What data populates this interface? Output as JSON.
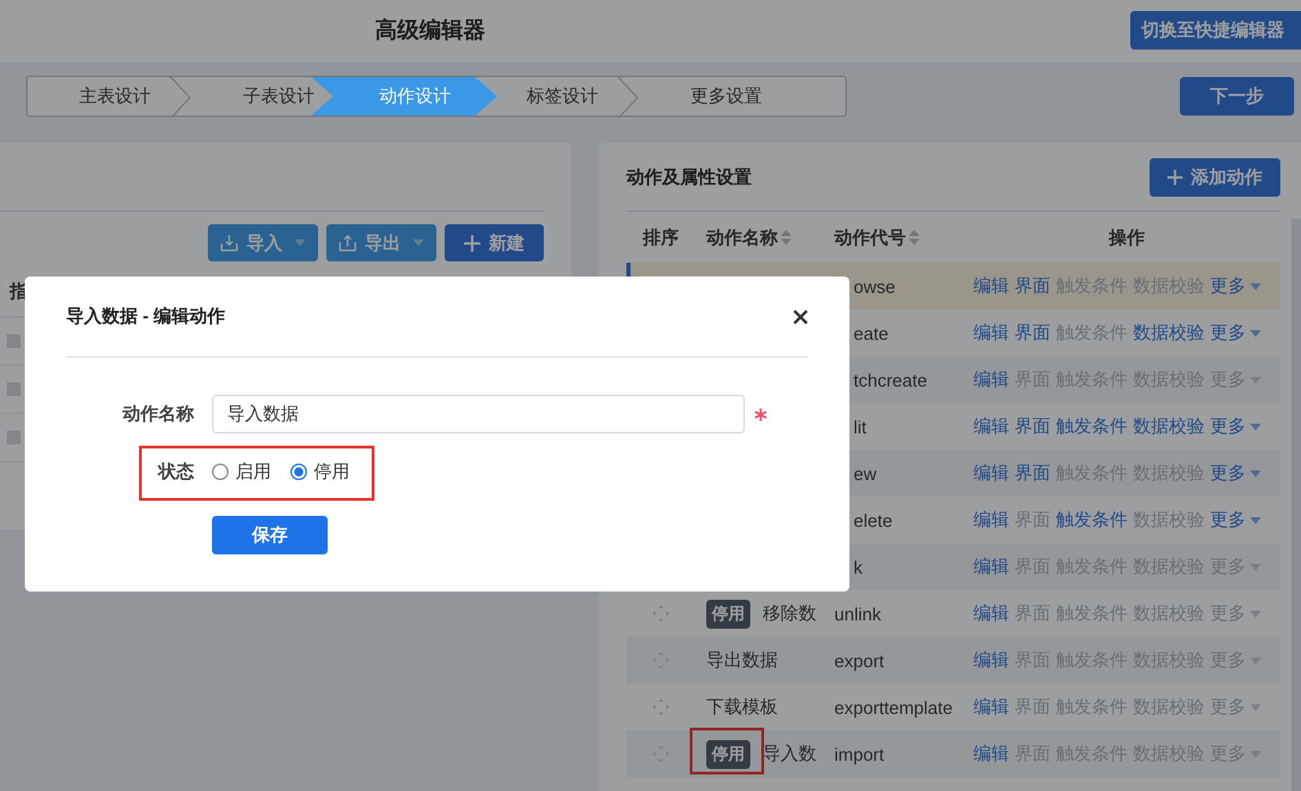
{
  "header": {
    "title": "高级编辑器",
    "switch_button": "切换至快捷编辑器"
  },
  "steps": [
    {
      "label": "主表设计",
      "selected": false
    },
    {
      "label": "子表设计",
      "selected": false
    },
    {
      "label": "动作设计",
      "selected": true
    },
    {
      "label": "标签设计",
      "selected": false
    },
    {
      "label": "更多设置",
      "selected": false
    }
  ],
  "next_button": "下一步",
  "left_panel": {
    "buttons": [
      {
        "kind": "import",
        "label": "导入"
      },
      {
        "kind": "export",
        "label": "导出"
      },
      {
        "kind": "new",
        "label": "新建"
      }
    ],
    "column_1": "指"
  },
  "actions_panel": {
    "title": "动作及属性设置",
    "add_button": "添加动作",
    "columns": [
      {
        "label": "排序",
        "kind": "plain"
      },
      {
        "label": "动作名称",
        "kind": "sortable"
      },
      {
        "label": "动作代号",
        "kind": "sortable"
      },
      {
        "label": "操作",
        "kind": "plain"
      }
    ],
    "rows": [
      {
        "code": "owse",
        "selected": true,
        "ops": [
          {
            "label": "编辑",
            "enabled": true
          },
          {
            "label": "界面",
            "enabled": true
          },
          {
            "label": "触发条件",
            "enabled": false
          },
          {
            "label": "数据校验",
            "enabled": false
          },
          {
            "label": "更多",
            "enabled": true
          }
        ]
      },
      {
        "code": "eate",
        "selected": false,
        "ops": [
          {
            "label": "编辑",
            "enabled": true
          },
          {
            "label": "界面",
            "enabled": true
          },
          {
            "label": "触发条件",
            "enabled": false
          },
          {
            "label": "数据校验",
            "enabled": true
          },
          {
            "label": "更多",
            "enabled": true
          }
        ]
      },
      {
        "code": "tchcreate",
        "selected": false,
        "ops": [
          {
            "label": "编辑",
            "enabled": true
          },
          {
            "label": "界面",
            "enabled": false
          },
          {
            "label": "触发条件",
            "enabled": false
          },
          {
            "label": "数据校验",
            "enabled": false
          },
          {
            "label": "更多",
            "enabled": false
          }
        ]
      },
      {
        "code": "lit",
        "selected": false,
        "ops": [
          {
            "label": "编辑",
            "enabled": true
          },
          {
            "label": "界面",
            "enabled": true
          },
          {
            "label": "触发条件",
            "enabled": true
          },
          {
            "label": "数据校验",
            "enabled": true
          },
          {
            "label": "更多",
            "enabled": true
          }
        ]
      },
      {
        "code": "ew",
        "selected": false,
        "ops": [
          {
            "label": "编辑",
            "enabled": true
          },
          {
            "label": "界面",
            "enabled": true
          },
          {
            "label": "触发条件",
            "enabled": false
          },
          {
            "label": "数据校验",
            "enabled": false
          },
          {
            "label": "更多",
            "enabled": true
          }
        ]
      },
      {
        "code": "elete",
        "selected": false,
        "ops": [
          {
            "label": "编辑",
            "enabled": true
          },
          {
            "label": "界面",
            "enabled": false
          },
          {
            "label": "触发条件",
            "enabled": true
          },
          {
            "label": "数据校验",
            "enabled": false
          },
          {
            "label": "更多",
            "enabled": true
          }
        ]
      },
      {
        "code": "k",
        "selected": false,
        "ops": [
          {
            "label": "编辑",
            "enabled": true
          },
          {
            "label": "界面",
            "enabled": false
          },
          {
            "label": "触发条件",
            "enabled": false
          },
          {
            "label": "数据校验",
            "enabled": false
          },
          {
            "label": "更多",
            "enabled": false
          }
        ]
      },
      {
        "badge": "停用",
        "name": "移除数",
        "code": "unlink",
        "selected": false,
        "ops": [
          {
            "label": "编辑",
            "enabled": true
          },
          {
            "label": "界面",
            "enabled": false
          },
          {
            "label": "触发条件",
            "enabled": false
          },
          {
            "label": "数据校验",
            "enabled": false
          },
          {
            "label": "更多",
            "enabled": false
          }
        ]
      },
      {
        "name": "导出数据",
        "code": "export",
        "selected": false,
        "ops": [
          {
            "label": "编辑",
            "enabled": true
          },
          {
            "label": "界面",
            "enabled": false
          },
          {
            "label": "触发条件",
            "enabled": false
          },
          {
            "label": "数据校验",
            "enabled": false
          },
          {
            "label": "更多",
            "enabled": false
          }
        ]
      },
      {
        "name": "下载模板",
        "code": "exporttemplate",
        "selected": false,
        "ops": [
          {
            "label": "编辑",
            "enabled": true
          },
          {
            "label": "界面",
            "enabled": false
          },
          {
            "label": "触发条件",
            "enabled": false
          },
          {
            "label": "数据校验",
            "enabled": false
          },
          {
            "label": "更多",
            "enabled": false
          }
        ]
      },
      {
        "badge": "停用",
        "name": "导入数",
        "code": "import",
        "selected": false,
        "marked": true,
        "ops": [
          {
            "label": "编辑",
            "enabled": true
          },
          {
            "label": "界面",
            "enabled": false
          },
          {
            "label": "触发条件",
            "enabled": false
          },
          {
            "label": "数据校验",
            "enabled": false
          },
          {
            "label": "更多",
            "enabled": false
          }
        ]
      }
    ]
  },
  "dialog": {
    "title": "导入数据 - 编辑动作",
    "name_label": "动作名称",
    "name_value": "导入数据",
    "required": true,
    "status": {
      "label": "状态",
      "marked": true,
      "options": [
        {
          "label": "启用",
          "selected": false
        },
        {
          "label": "停用",
          "selected": true
        }
      ]
    },
    "save_button": "保存"
  }
}
